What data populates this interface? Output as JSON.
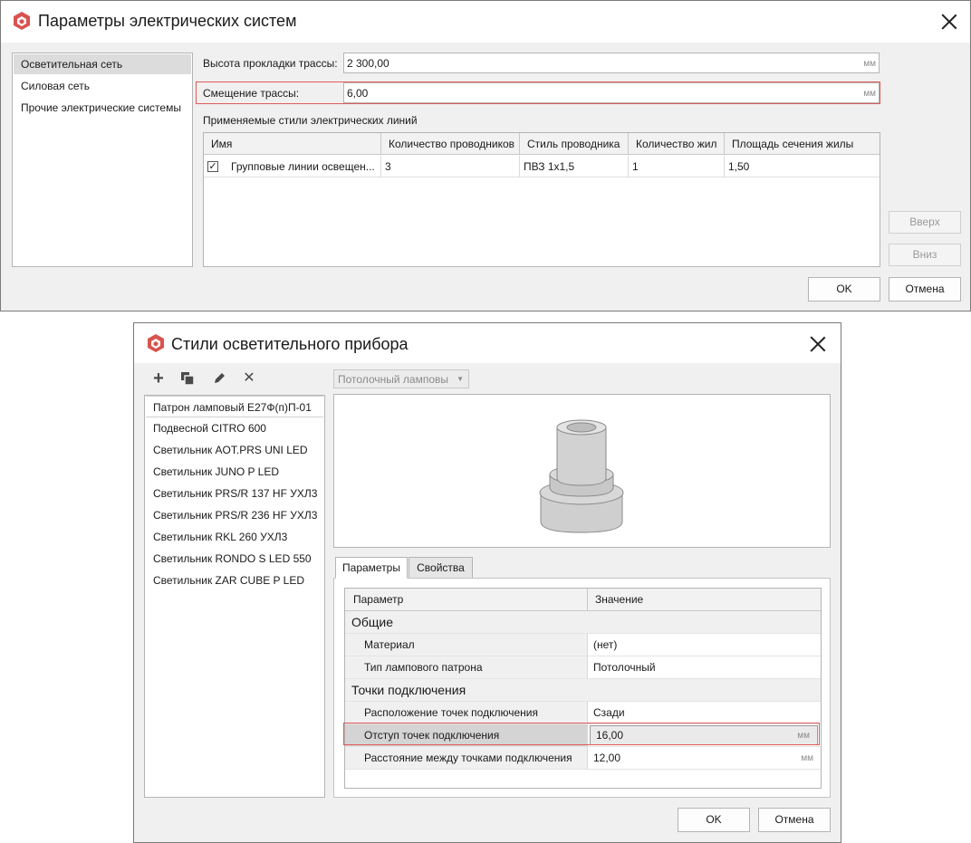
{
  "dialog1": {
    "title": "Параметры электрических систем",
    "nav": [
      "Осветительная сеть",
      "Силовая сеть",
      "Прочие электрические системы"
    ],
    "route_height_label": "Высота прокладки трассы:",
    "route_height_value": "2 300,00",
    "route_height_unit": "мм",
    "route_offset_label": "Смещение трассы:",
    "route_offset_value": "6,00",
    "route_offset_unit": "мм",
    "styles_section_label": "Применяемые стили электрических линий",
    "columns": [
      "Имя",
      "Количество проводников",
      "Стиль проводника",
      "Количество жил",
      "Площадь сечения жилы"
    ],
    "rows": [
      {
        "checked": "✓",
        "name": "Групповые линии освещен...",
        "conductors": "3",
        "style": "ПВЗ 1x1,5",
        "cores": "1",
        "area": "1,50"
      }
    ],
    "up_button": "Вверх",
    "down_button": "Вниз",
    "ok_button": "OK",
    "cancel_button": "Отмена"
  },
  "dialog2": {
    "title": "Стили осветительного прибора",
    "items": [
      "Патрон ламповый Е27Ф(п)П-01",
      "Подвесной CITRO 600",
      "Светильник AOT.PRS UNI LED",
      "Светильник JUNO P LED",
      "Светильник PRS/R 137 HF УХЛ3",
      "Светильник PRS/R 236 HF УХЛ3",
      "Светильник RKL 260 УХЛ3",
      "Светильник RONDO S LED 550",
      "Светильник ZAR CUBE P LED"
    ],
    "type_combo_value": "Потолочный ламповы",
    "tabs": [
      "Параметры",
      "Свойства"
    ],
    "grid_header_param": "Параметр",
    "grid_header_value": "Значение",
    "cat_general": "Общие",
    "material_label": "Материал",
    "material_value": "(нет)",
    "socket_type_label": "Тип лампового патрона",
    "socket_type_value": "Потолочный",
    "cat_points": "Точки подключения",
    "points_location_label": "Расположение точек подключения",
    "points_location_value": "Сзади",
    "points_offset_label": "Отступ точек подключения",
    "points_offset_value": "16,00",
    "points_offset_unit": "мм",
    "points_distance_label": "Расстояние между точками подключения",
    "points_distance_value": "12,00",
    "points_distance_unit": "мм",
    "ok_button": "OK",
    "cancel_button": "Отмена"
  },
  "icons": {
    "app": "app-cube-icon",
    "add": "plus-icon",
    "copy": "copy-icon",
    "edit": "pencil-icon",
    "delete": "delete-icon"
  },
  "colors": {
    "accent_red": "#e05a5a",
    "app_icon": "#d9534f"
  }
}
